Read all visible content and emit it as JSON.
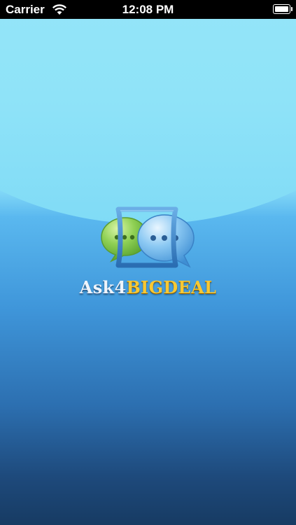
{
  "status_bar": {
    "carrier": "Carrier",
    "time": "12:08 PM",
    "battery_level": 1.0,
    "wifi_icon": "wifi-icon",
    "battery_icon": "battery-icon"
  },
  "splash": {
    "logo_icon": "chat-bubbles-logo-icon",
    "brand_part_a": "Ask4",
    "brand_part_b": "BIGDEAL"
  },
  "colors": {
    "brand_white": "#eef4fb",
    "brand_gold": "#f7c833",
    "bubble_green": "#7cc24a",
    "bubble_blue": "#6fb8ee",
    "frame_blue": "#3f86c8",
    "background_top": "#8fe6fb",
    "background_bottom": "#173b63"
  }
}
